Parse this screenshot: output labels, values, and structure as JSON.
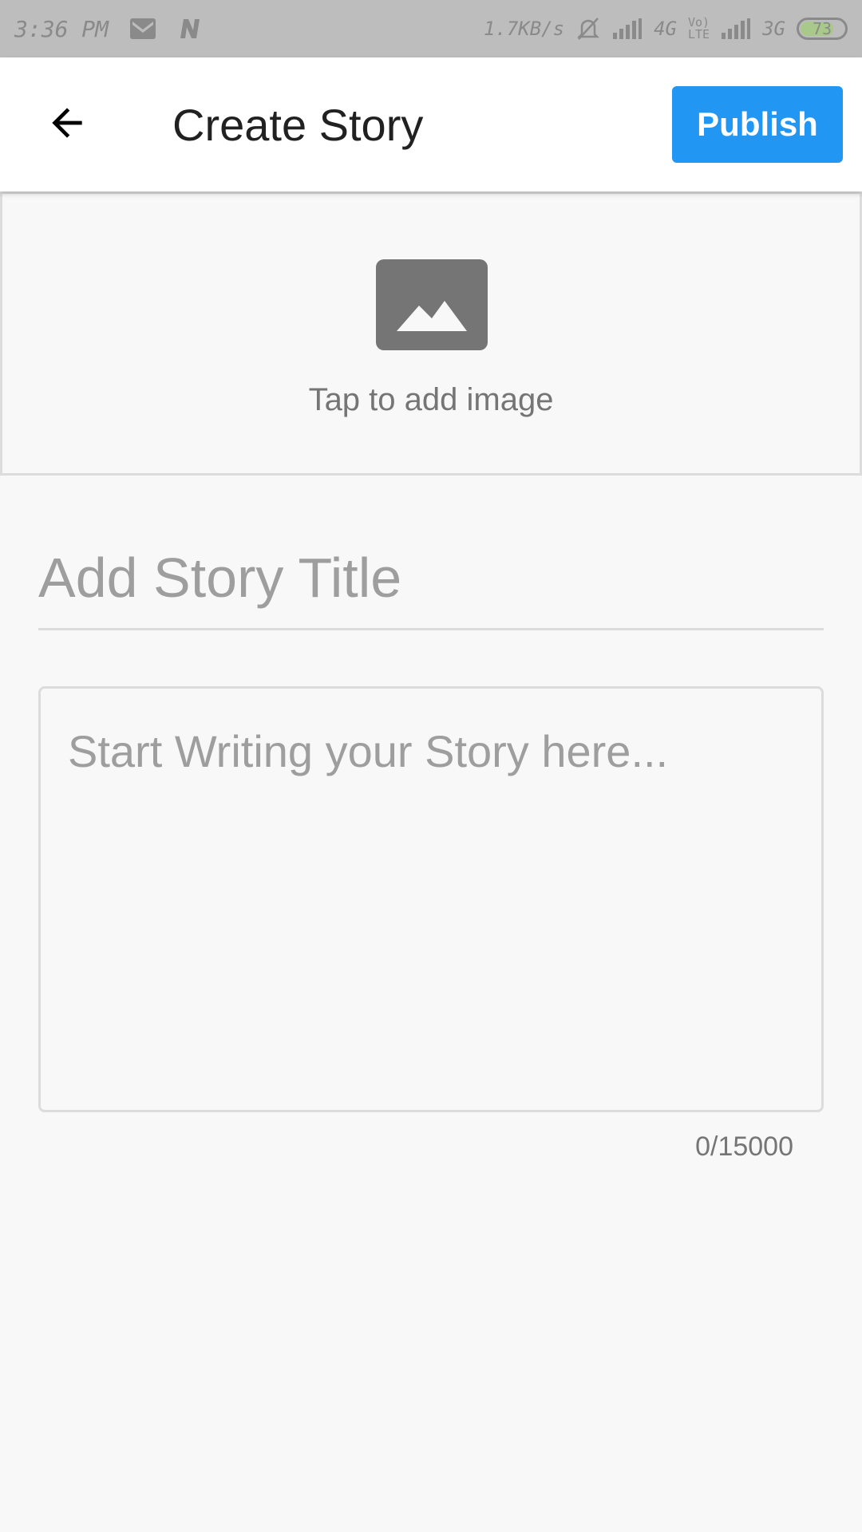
{
  "status_bar": {
    "time": "3:36 PM",
    "network_speed": "1.7KB/s",
    "network_4g": "4G",
    "volte_top": "Vo)",
    "volte_bottom": "LTE",
    "network_3g": "3G",
    "battery_level": "73",
    "icons": [
      "gmail-icon",
      "n-icon",
      "mute-icon",
      "signal-icon",
      "signal-icon",
      "battery-icon"
    ]
  },
  "app_bar": {
    "title": "Create Story",
    "publish_label": "Publish",
    "back_icon": "arrow-back-icon"
  },
  "image_picker": {
    "icon": "image-icon",
    "label": "Tap to add image"
  },
  "title_field": {
    "value": "",
    "placeholder": "Add Story Title"
  },
  "story_field": {
    "value": "",
    "placeholder": "Start Writing your Story here..."
  },
  "char_counter": "0/15000",
  "colors": {
    "accent": "#2196f3",
    "app_bar_bg": "#ffffff",
    "page_bg": "#f8f8f8",
    "status_bar_bg": "#bdbdbd",
    "title_text": "#212121",
    "hint_text": "#9e9e9e",
    "image_icon": "#757575"
  }
}
